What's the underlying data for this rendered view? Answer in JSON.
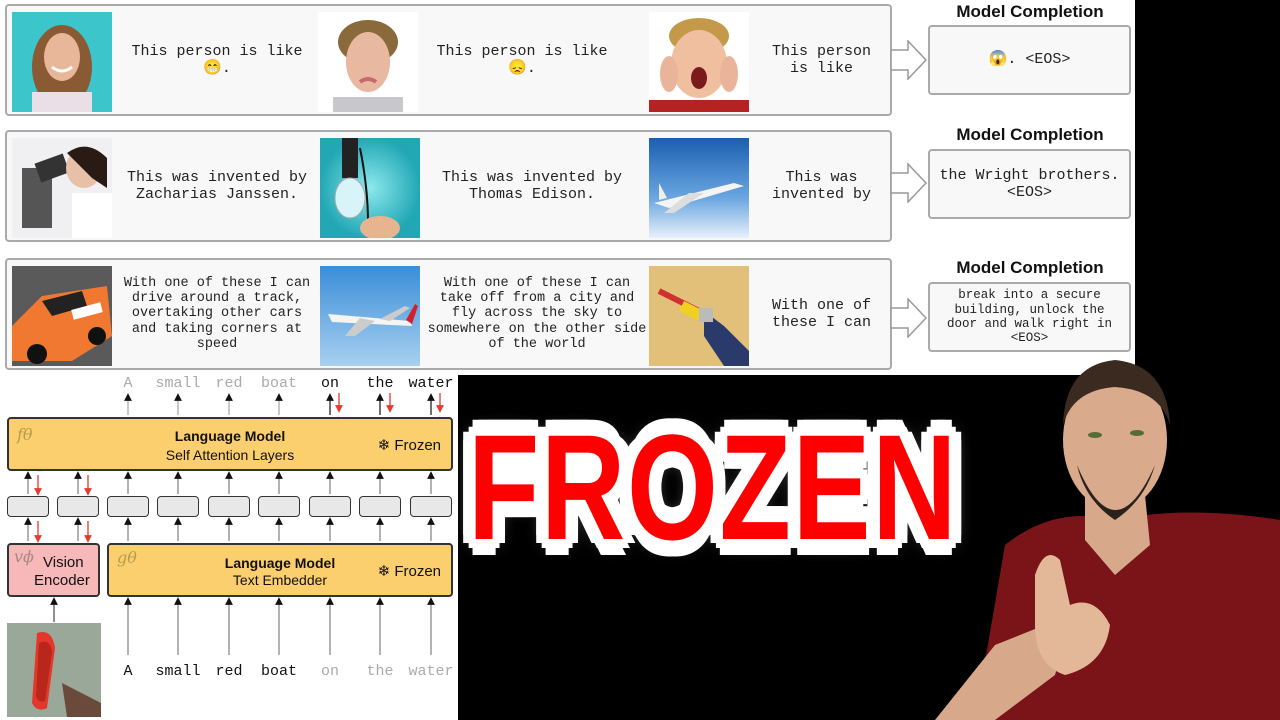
{
  "examples": [
    {
      "prompt_1": {
        "image": "smiling-woman-photo",
        "text": "This person is like 😁."
      },
      "prompt_2": {
        "image": "sad-man-photo",
        "text": "This person is like 😞."
      },
      "query": {
        "image": "screaming-boy-photo",
        "text": "This person is like"
      },
      "completion_title": "Model Completion",
      "completion": "😱. <EOS>"
    },
    {
      "prompt_1": {
        "image": "microscope-scientist-photo",
        "text": "This was invented by Zacharias Janssen."
      },
      "prompt_2": {
        "image": "light-bulb-photo",
        "text": "This was invented by Thomas Edison."
      },
      "query": {
        "image": "airplane-in-sky-photo",
        "text": "This was invented by"
      },
      "completion_title": "Model Completion",
      "completion": "the Wright brothers. <EOS>"
    },
    {
      "prompt_1": {
        "image": "race-car-photo",
        "text": "With one of these I can drive around a track, overtaking other cars and taking corners at speed"
      },
      "prompt_2": {
        "image": "airliner-photo",
        "text": "With one of these I can take off from a city and fly across the sky to somewhere on the other side of the world"
      },
      "query": {
        "image": "power-drill-photo",
        "text": "With one of these I can"
      },
      "completion_title": "Model Completion",
      "completion": "break into a secure building, unlock the door and walk right in  <EOS>"
    }
  ],
  "diagram": {
    "output_words": [
      {
        "text": "A",
        "style": "dim"
      },
      {
        "text": "small",
        "style": "dim"
      },
      {
        "text": "red",
        "style": "dim"
      },
      {
        "text": "boat",
        "style": "dim"
      },
      {
        "text": "on",
        "style": "dark"
      },
      {
        "text": "the",
        "style": "dark"
      },
      {
        "text": "water",
        "style": "dark"
      }
    ],
    "input_words": [
      {
        "text": "A",
        "style": "dark"
      },
      {
        "text": "small",
        "style": "dark"
      },
      {
        "text": "red",
        "style": "dark"
      },
      {
        "text": "boat",
        "style": "dark"
      },
      {
        "text": "on",
        "style": "dim"
      },
      {
        "text": "the",
        "style": "dim"
      },
      {
        "text": "water",
        "style": "dim"
      }
    ],
    "self_attention": {
      "symbol": "fθ",
      "title": "Language Model",
      "subtitle": "Self Attention Layers",
      "frozen_label": "❄ Frozen"
    },
    "text_embedder": {
      "symbol": "gθ",
      "title": "Language Model",
      "subtitle": "Text Embedder",
      "frozen_label": "❄ Frozen"
    },
    "vision_encoder": {
      "symbol": "vϕ",
      "title": "Vision",
      "subtitle": "Encoder"
    },
    "input_image": "red-boat-photo",
    "colors": {
      "language_model": "#fbcf6e",
      "vision_encoder": "#f6b8b8",
      "gradient_arrow": "#e8392b",
      "token_box": "#e8e8e8"
    }
  },
  "headline": {
    "text": "FROZEN",
    "color": "#ff0000"
  },
  "presenter": {
    "image": "presenter-thumbs-up-photo"
  }
}
